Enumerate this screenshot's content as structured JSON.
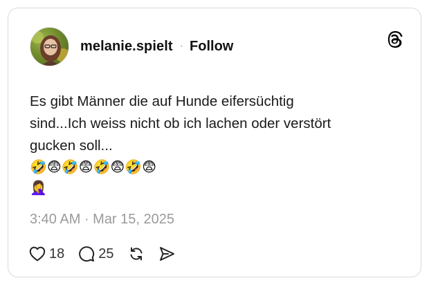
{
  "post": {
    "username": "melanie.spielt",
    "separator": "·",
    "follow_label": "Follow",
    "text_lines": [
      "Es gibt Männer die auf Hunde eifersüchtig",
      "sind...Ich weiss nicht ob ich lachen oder verstört",
      "gucken soll..."
    ],
    "emoji_line_1": "🤣😨🤣😨🤣😨🤣😨",
    "emoji_line_2": "🤦‍♀️",
    "timestamp": "3:40 AM · Mar 15, 2025"
  },
  "actions": {
    "like_count": "18",
    "reply_count": "25"
  },
  "icons": {
    "brand": "threads-logo-icon",
    "like": "heart-icon",
    "reply": "comment-bubble-icon",
    "repost": "repost-icon",
    "share": "send-icon"
  },
  "colors": {
    "border": "#d9d9d9",
    "muted": "#9a9a9a",
    "text": "#1a1a1a"
  }
}
